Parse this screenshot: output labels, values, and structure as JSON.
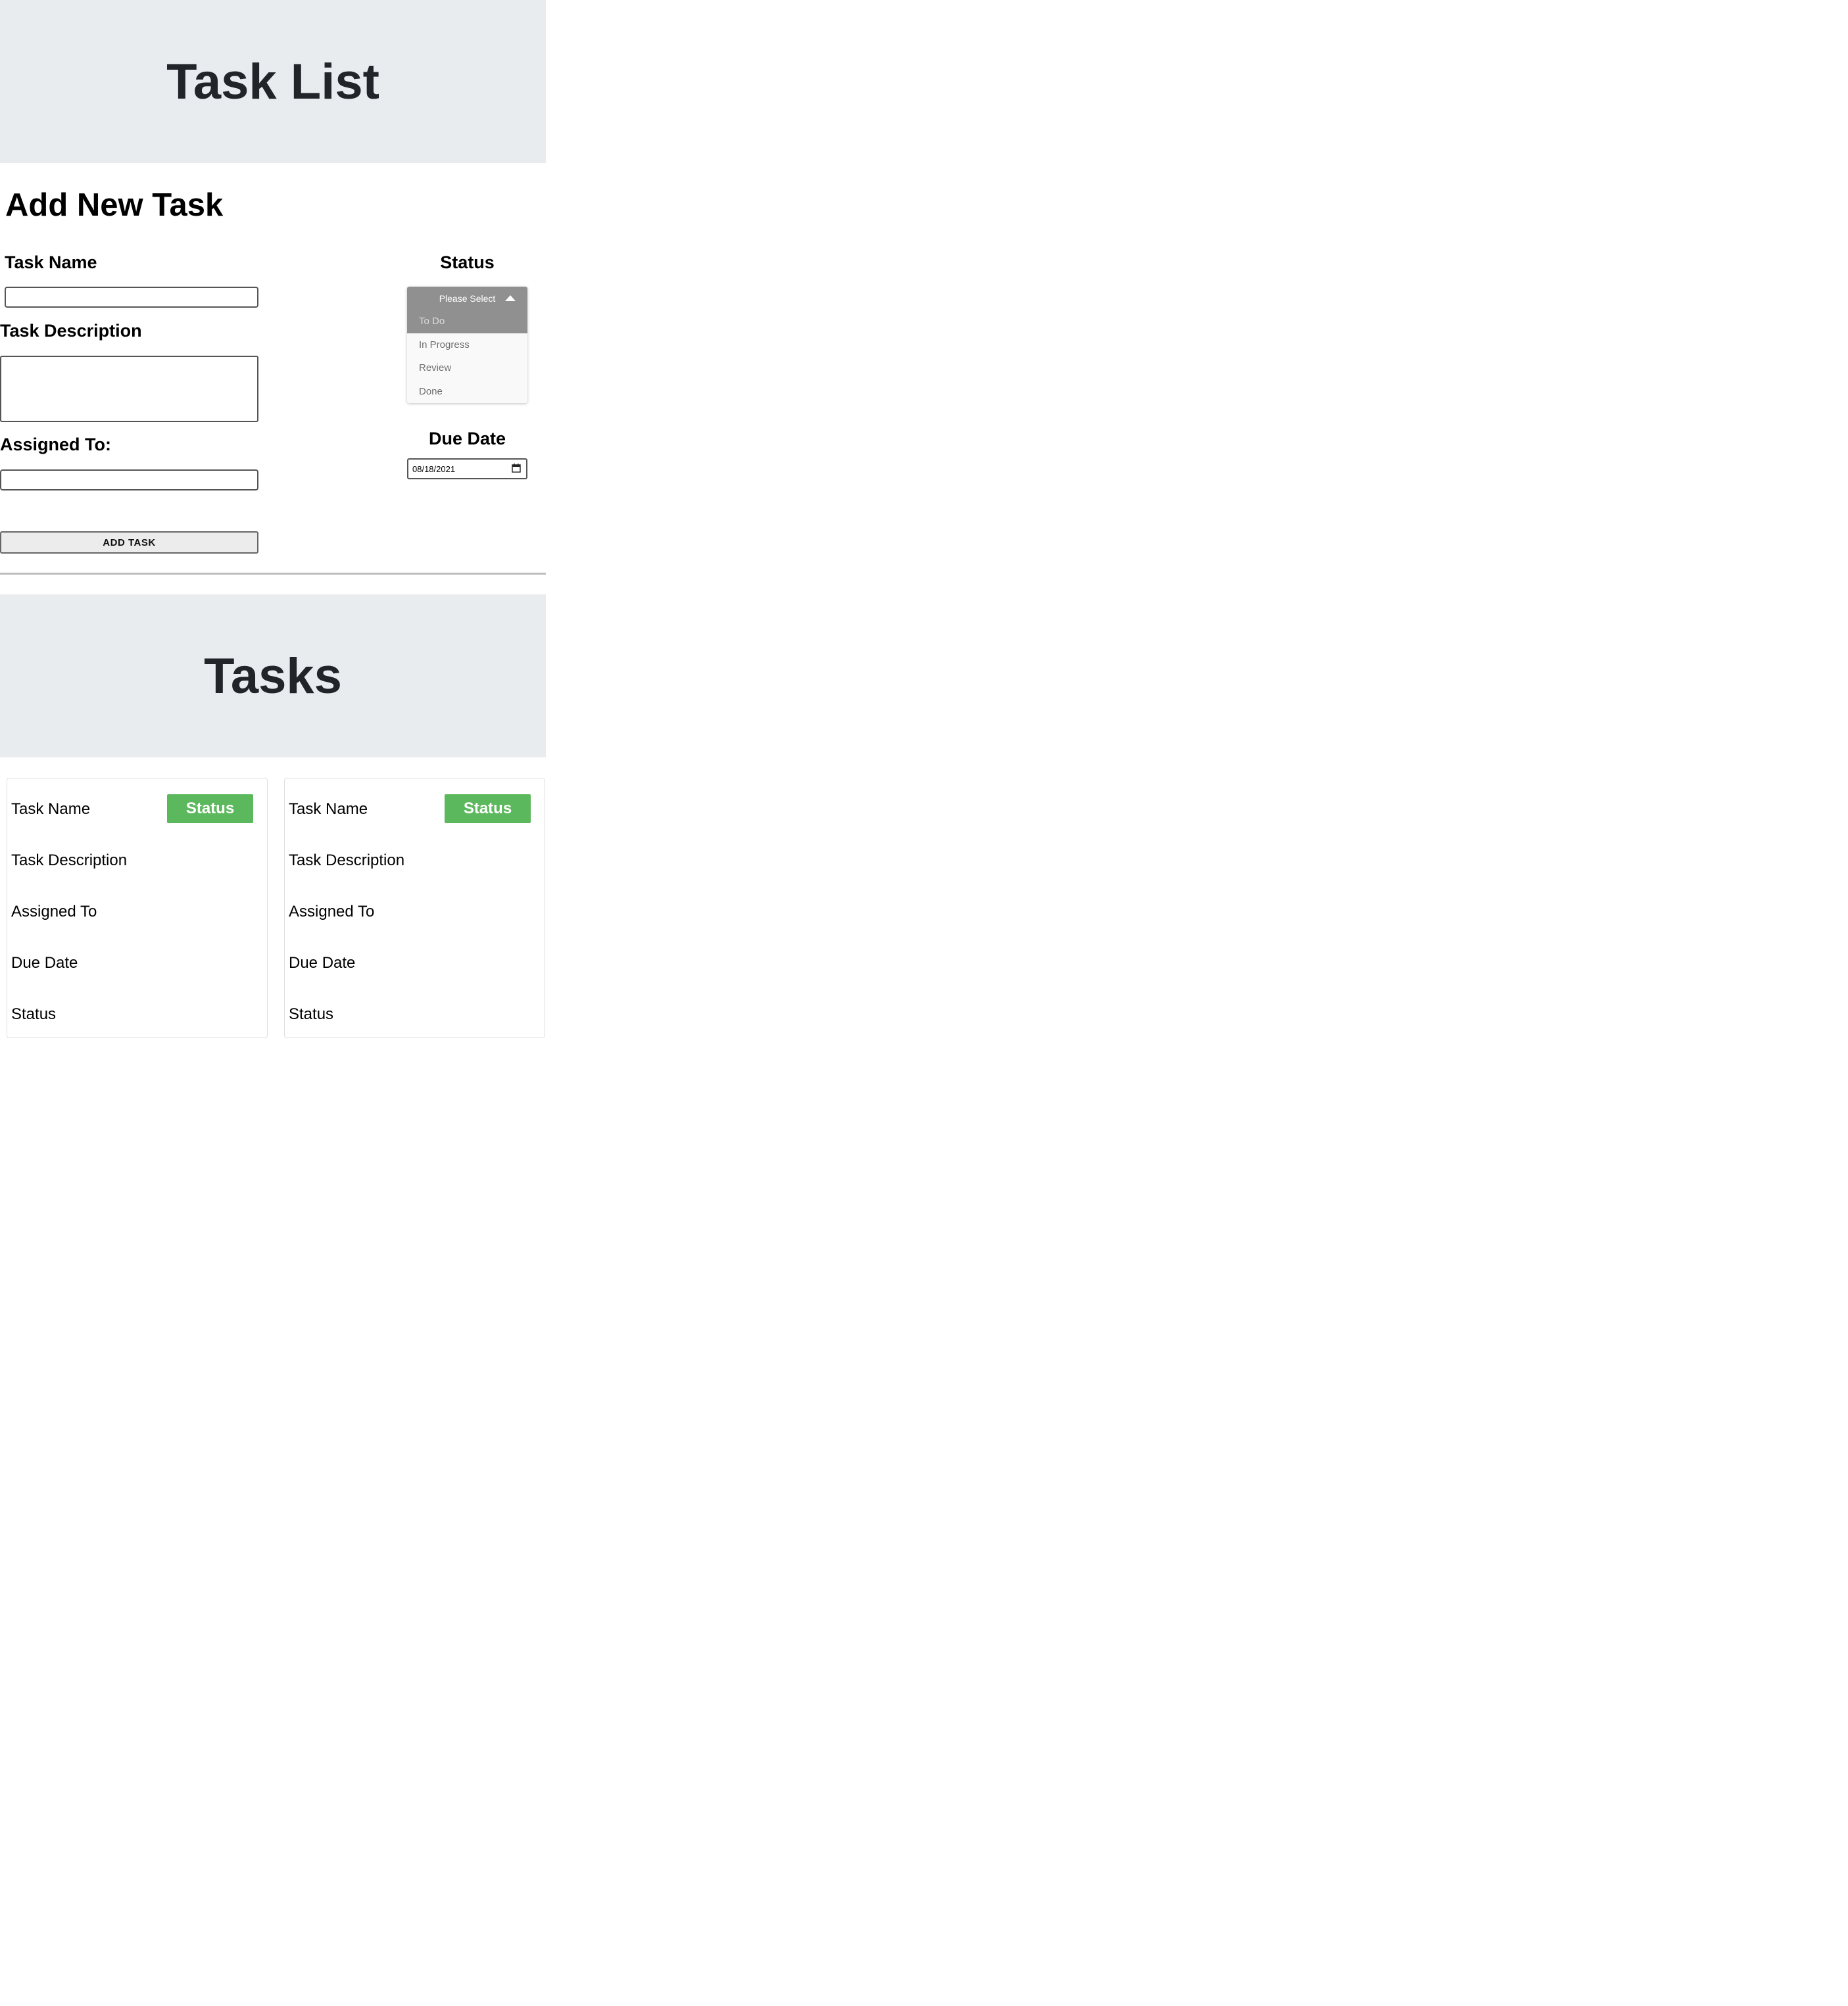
{
  "header": {
    "title": "Task List"
  },
  "form": {
    "section_title": "Add New Task",
    "task_name_label": "Task Name",
    "task_name_value": "",
    "task_description_label": "Task Description",
    "task_description_value": "",
    "assigned_to_label": "Assigned To:",
    "assigned_to_value": "",
    "status_label": "Status",
    "status_dropdown": {
      "placeholder": "Please Select",
      "expanded": true,
      "highlighted": "To Do",
      "options": [
        "To Do",
        "In Progress",
        "Review",
        "Done"
      ]
    },
    "due_date_label": "Due Date",
    "due_date_value": "08/18/2021",
    "add_button_label": "ADD TASK"
  },
  "tasks_header": {
    "title": "Tasks"
  },
  "tasks": [
    {
      "name": "Task Name",
      "badge": "Status",
      "description": "Task Description",
      "assigned_to": "Assigned To",
      "due_date": "Due Date",
      "status": "Status"
    },
    {
      "name": "Task Name",
      "badge": "Status",
      "description": "Task Description",
      "assigned_to": "Assigned To",
      "due_date": "Due Date",
      "status": "Status"
    }
  ],
  "colors": {
    "banner_bg": "#e9ecef",
    "badge_bg": "#5cb85c",
    "dropdown_header_bg": "#909090"
  },
  "icons": {
    "dropdown_caret": "caret-up-icon",
    "date_picker": "calendar-icon"
  }
}
